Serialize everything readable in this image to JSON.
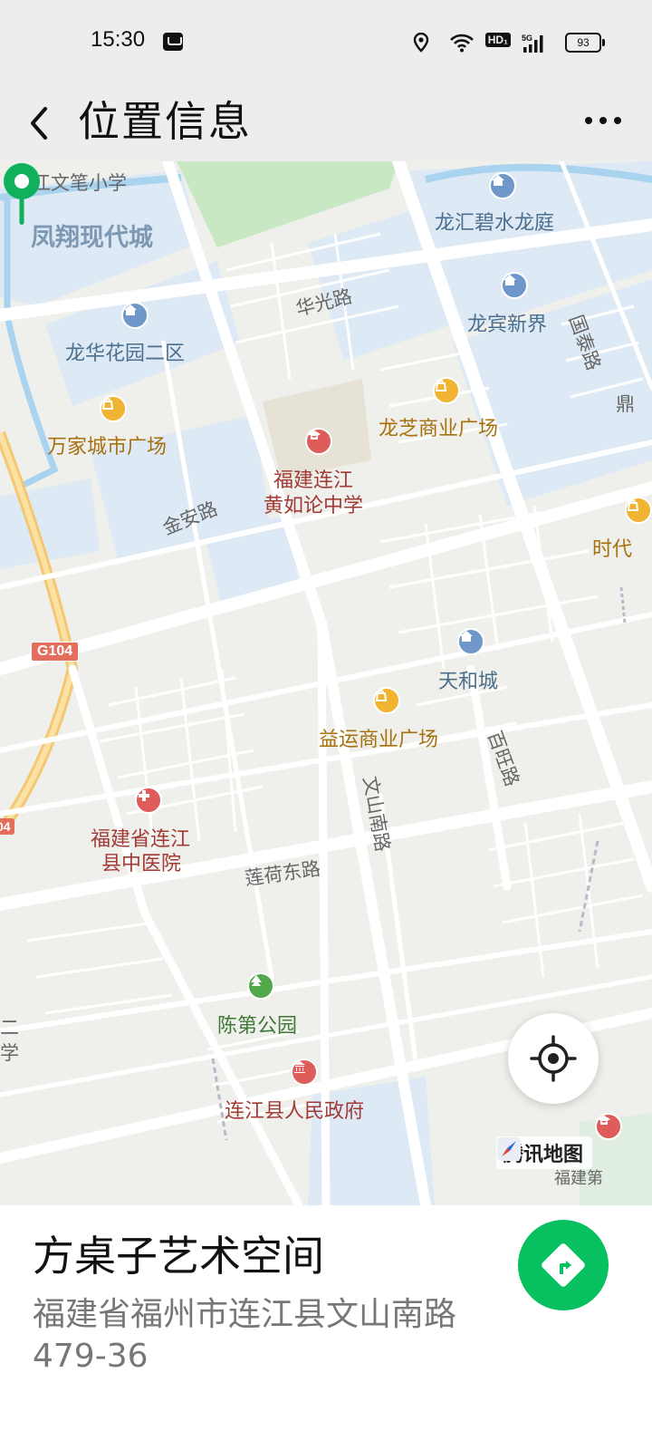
{
  "status_bar": {
    "time": "15:30",
    "network_badge": "HD₁",
    "signal_label": "5G",
    "battery": "93",
    "icons": [
      "message-icon",
      "location-icon",
      "wifi-icon",
      "hd-icon",
      "signal-icon",
      "battery-icon"
    ]
  },
  "header": {
    "back_icon": "chevron-left-icon",
    "title": "位置信息",
    "more_icon": "more-dots-icon"
  },
  "map": {
    "labels": {
      "lianjiang_wenbi_school": "连江文笔小学",
      "fengxiang_city": "凤翔现代城",
      "longhui": "龙汇碧水龙庭",
      "huaguang_road": "华光路",
      "longbin": "龙宾新界",
      "guotai_road": "国泰路",
      "longhua": "龙华花园二区",
      "wanjiacheng": "万家城市广场",
      "longzhi": "龙芝商业广场",
      "ding": "鼎",
      "school_line1": "福建连江",
      "school_line2": "黄如论中学",
      "jinan_road": "金安路",
      "shidai": "时代",
      "g104": "G104",
      "g104_edge": "04",
      "tianhe": "天和城",
      "yiyun": "益运商业广场",
      "baiwang_road": "百旺路",
      "wenshan_road": "文山南路",
      "hospital_line1": "福建省连江",
      "hospital_line2": "县中医院",
      "lianhe_road": "莲荷东路",
      "edge_er": "二",
      "edge_xue": "学",
      "chendi_park": "陈第公园",
      "government": "连江县人民政府",
      "edge_fujian": "福建第"
    },
    "brand": "腾讯地图",
    "locate_icon": "crosshair-locate-icon",
    "pin_icon": "location-pin-icon"
  },
  "place": {
    "name": "方桌子艺术空间",
    "address": "福建省福州市连江县文山南路479-36",
    "navigate_icon": "navigate-diamond-icon"
  },
  "colors": {
    "accent_green": "#07c160",
    "pin_green": "#10b05c",
    "water": "#a9d3ee",
    "block_blue": "#dde9f5"
  }
}
